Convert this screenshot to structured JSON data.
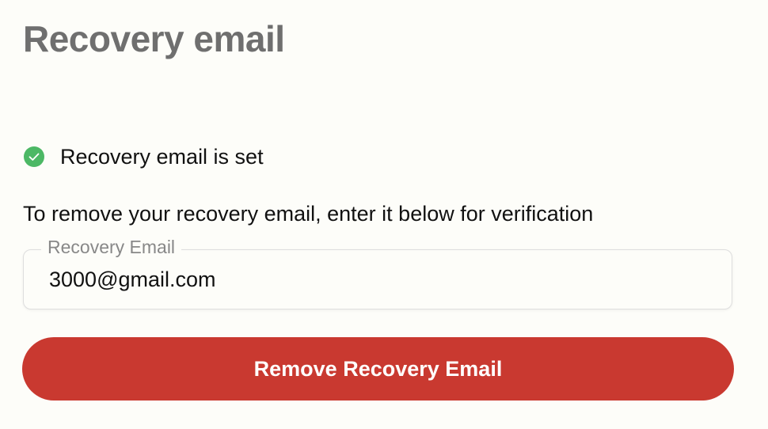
{
  "page": {
    "title": "Recovery email"
  },
  "status": {
    "icon": "check-circle-icon",
    "icon_color": "#4cb865",
    "text": "Recovery email is set"
  },
  "instruction": "To remove your recovery email, enter it below for verification",
  "email_field": {
    "label": "Recovery Email",
    "value": "3000@gmail.com"
  },
  "remove_button": {
    "label": "Remove Recovery Email",
    "color": "#c93930"
  }
}
